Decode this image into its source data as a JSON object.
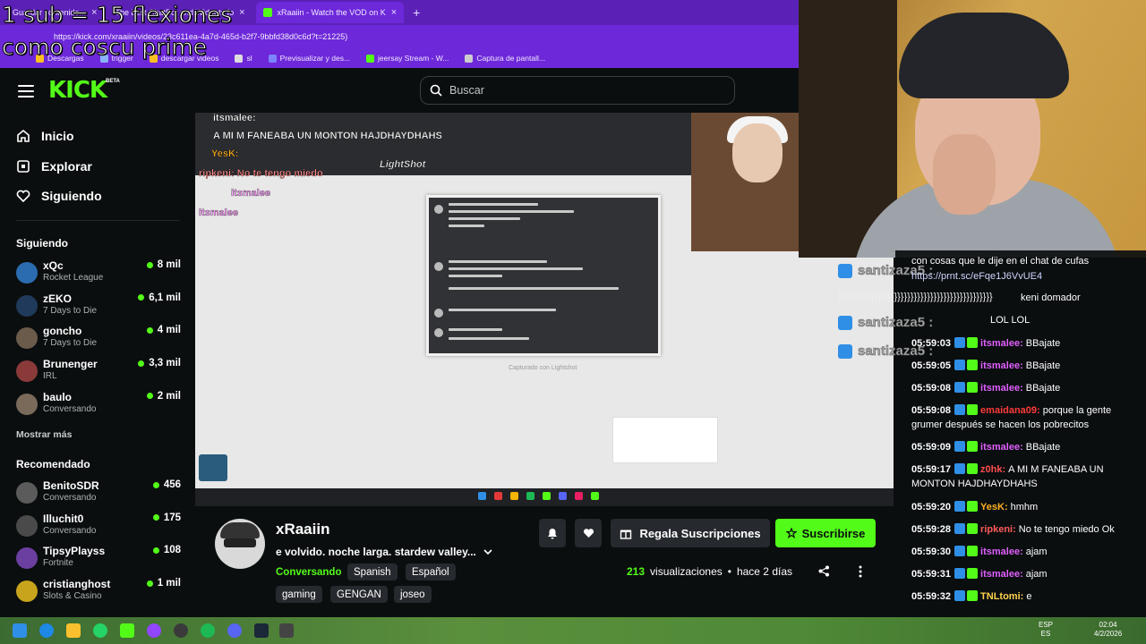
{
  "overlay": {
    "line1": "1 sub = 15 flexiones",
    "line2": "como coscu prime"
  },
  "browser": {
    "tabs": [
      {
        "label": "Guardar contenido..."
      },
      {
        "label": "The best ChatBot and Widgets fo"
      },
      {
        "label": "xRaaiin - Watch the VOD on K"
      }
    ],
    "url": "https://kick.com/xraaiin/videos/23c611ea-4a7d-465d-b2f7-9bbfd38d0c6d?t=21225)",
    "bookmarks": [
      "Descargas",
      "trigger",
      "descargar videos",
      "sl",
      "Previsualizar y des...",
      "jeersay Stream - W...",
      "Captura de pantall..."
    ]
  },
  "kick": {
    "logo": "KICK",
    "beta": "BETA",
    "search_placeholder": "Buscar",
    "nav": {
      "home": "Inicio",
      "explore": "Explorar",
      "following": "Siguiendo"
    },
    "following_title": "Siguiendo",
    "following": [
      {
        "name": "xQc",
        "category": "Rocket League",
        "viewers": "8 mil",
        "color": "#2b6cb0"
      },
      {
        "name": "zEKO",
        "category": "7 Days to Die",
        "viewers": "6,1 mil",
        "color": "#1f3a5a"
      },
      {
        "name": "goncho",
        "category": "7 Days to Die",
        "viewers": "4 mil",
        "color": "#6b5b4b"
      },
      {
        "name": "Brunenger",
        "category": "IRL",
        "viewers": "3,3 mil",
        "color": "#8b3a3a"
      },
      {
        "name": "baulo",
        "category": "Conversando",
        "viewers": "2 mil",
        "color": "#7a6a5a"
      }
    ],
    "show_more": "Mostrar más",
    "recommended_title": "Recomendado",
    "recommended": [
      {
        "name": "BenitoSDR",
        "category": "Conversando",
        "viewers": "456",
        "color": "#5b5b5b"
      },
      {
        "name": "Illuchit0",
        "category": "Conversando",
        "viewers": "175",
        "color": "#4a4a4a"
      },
      {
        "name": "TipsyPlayss",
        "category": "Fortnite",
        "viewers": "108",
        "color": "#6b3fa0"
      },
      {
        "name": "cristianghost",
        "category": "Slots & Casino",
        "viewers": "1 mil",
        "color": "#c8a41c"
      }
    ]
  },
  "video_overlay": {
    "chat1_user": "itsmalee:",
    "chat2": "A MI M FANEABA UN MONTON HAJDHAYDHAHS",
    "chat3": "YesK:",
    "chat4": "ripkeni: No te tengo miedo",
    "chat5": "itsmalee",
    "chat6": "itsmalee",
    "lightshot": "LightShot",
    "caption": "Capturado con Lightshot"
  },
  "chat": {
    "alerts": [
      {
        "name": "santizaza5 :"
      },
      {
        "name": "santizaza5 :"
      },
      {
        "name": "santizaza5 :"
      }
    ],
    "top_text": "con cosas que le dije en el chat de cufas",
    "link": "https://prnt.sc/eFqe1J6VvUE4",
    "spam": "}}}}}}}}}}}}}}}}}}}}}}}}}}}}}}}}}}}}}}}}}}}}}}}",
    "spam_tail": "keni domador",
    "partial1": "LOL LOL",
    "messages": [
      {
        "ts": "05:59:03",
        "user": "itsmalee:",
        "text": "BBajate",
        "color": "#e15fff"
      },
      {
        "ts": "05:59:05",
        "user": "itsmalee:",
        "text": "BBajate",
        "color": "#e15fff"
      },
      {
        "ts": "05:59:08",
        "user": "itsmalee:",
        "text": "BBajate",
        "color": "#e15fff"
      },
      {
        "ts": "05:59:08",
        "user": "emaidana09:",
        "text": "porque la gente grumer después se hacen los pobrecitos",
        "color": "#ff3b3b"
      },
      {
        "ts": "05:59:09",
        "user": "itsmalee:",
        "text": "BBajate",
        "color": "#e15fff"
      },
      {
        "ts": "05:59:17",
        "user": "z0hk:",
        "text": "A MI M FANEABA UN MONTON HAJDHAYDHAHS",
        "color": "#ff4d4d"
      },
      {
        "ts": "05:59:20",
        "user": "YesK:",
        "text": "hmhm",
        "color": "#ffb020"
      },
      {
        "ts": "05:59:28",
        "user": "ripkeni:",
        "text": "No te tengo miedo Ok",
        "color": "#ff5a5a"
      },
      {
        "ts": "05:59:30",
        "user": "itsmalee:",
        "text": "ajam",
        "color": "#e15fff"
      },
      {
        "ts": "05:59:31",
        "user": "itsmalee:",
        "text": "ajam",
        "color": "#e15fff"
      },
      {
        "ts": "05:59:32",
        "user": "TNLtomi:",
        "text": "e",
        "color": "#ffd24d"
      }
    ]
  },
  "channel": {
    "name": "xRaaiin",
    "title": "e volvido. noche larga. stardew valley...",
    "category": "Conversando",
    "tags": [
      "Spanish",
      "Español",
      "gaming",
      "GENGAN",
      "joseo"
    ],
    "gift_label": "Regala Suscripciones",
    "subscribe_label": "Suscribirse",
    "views_count": "213",
    "views_label": "visualizaciones",
    "separator": "•",
    "date": "hace 2 días"
  },
  "taskbar": {
    "lang1": "ESP",
    "lang2": "ES",
    "time": "02:04",
    "date": "4/2/2026"
  }
}
